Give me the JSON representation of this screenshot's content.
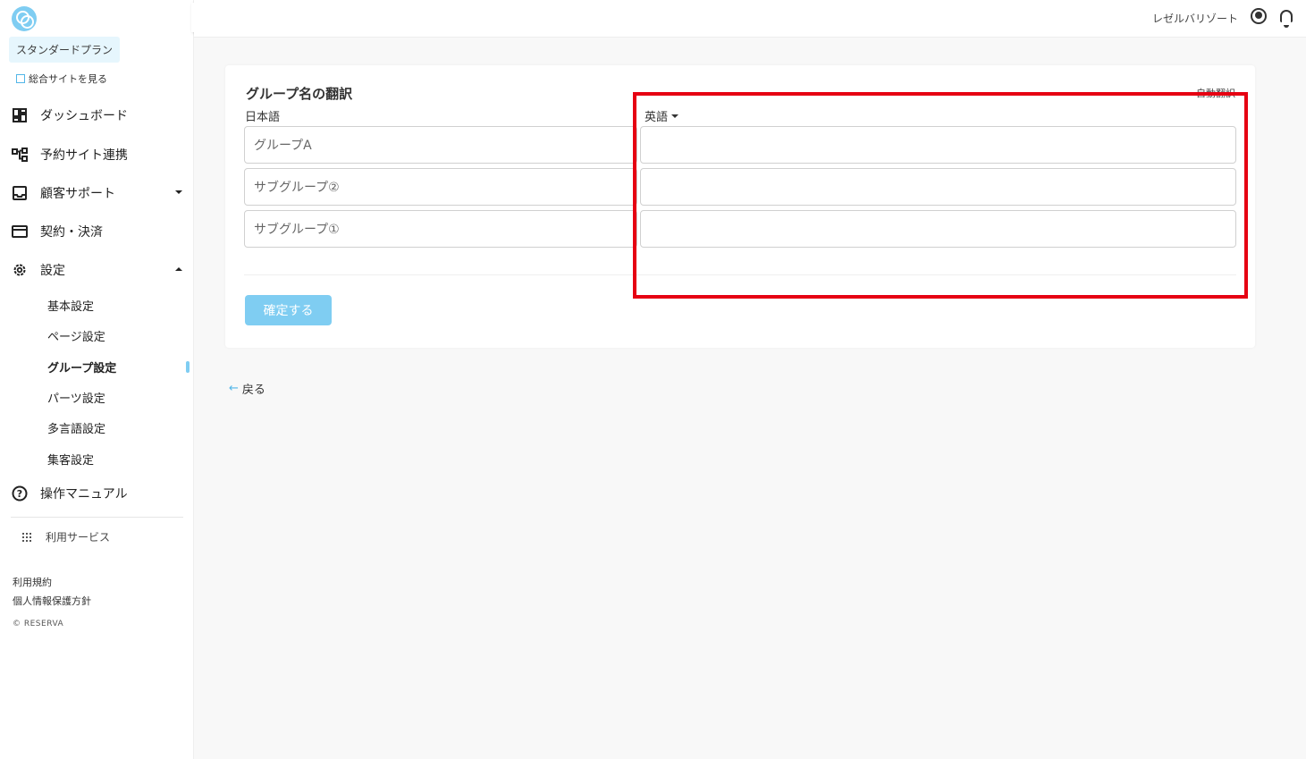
{
  "sidebar": {
    "plan_badge": "スタンダードプラン",
    "site_link": "総合サイトを見る",
    "nav": [
      {
        "label": "ダッシュボード",
        "icon": "dashboard-icon"
      },
      {
        "label": "予約サイト連携",
        "icon": "hierarchy-icon"
      },
      {
        "label": "顧客サポート",
        "icon": "inbox-icon"
      },
      {
        "label": "契約・決済",
        "icon": "credit-card-icon"
      },
      {
        "label": "設定",
        "icon": "gear-icon"
      },
      {
        "label": "操作マニュアル",
        "icon": "help-icon"
      }
    ],
    "settings_sub": [
      "基本設定",
      "ページ設定",
      "グループ設定",
      "パーツ設定",
      "多言語設定",
      "集客設定"
    ],
    "services_label": "利用サービス",
    "footer_links": [
      "利用規約",
      "個人情報保護方針"
    ],
    "copyright": "© RESERVA"
  },
  "header": {
    "shop_name": "レゼルバリゾート"
  },
  "card": {
    "title": "グループ名の翻訳",
    "auto_translate": "自動翻訳",
    "col_ja": "日本語",
    "col_en": "英語",
    "rows": [
      {
        "ja": "グループA",
        "en": ""
      },
      {
        "ja": "サブグループ②",
        "en": ""
      },
      {
        "ja": "サブグループ①",
        "en": ""
      }
    ],
    "confirm_label": "確定する"
  },
  "back_label": "戻る",
  "colors": {
    "accent": "#7fcdf2",
    "highlight": "#e60012"
  }
}
